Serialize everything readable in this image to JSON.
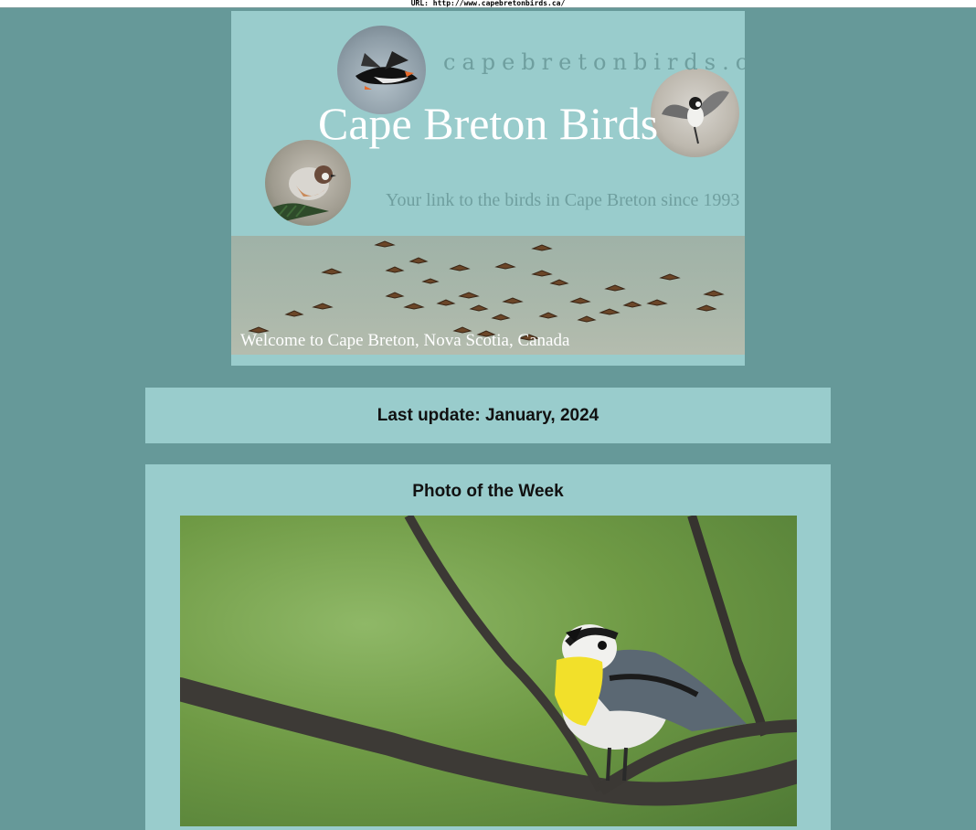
{
  "browser": {
    "url_text": "URL: http://www.capebretonbirds.ca/"
  },
  "banner": {
    "site_url": "capebretonbirds.ca",
    "title": "Cape Breton Birds",
    "tagline": "Your link to the birds in Cape Breton since 1993",
    "welcome": "Welcome to Cape Breton, Nova Scotia, Canada",
    "icons": [
      "puffin-photo",
      "chickadee-flying-photo",
      "boreal-chickadee-photo",
      "shorebird-flock-photo"
    ]
  },
  "update": {
    "text": "Last update: January, 2024"
  },
  "photo_of_week": {
    "title": "Photo of the Week",
    "image": "yellow-throated-warbler-photo"
  },
  "colors": {
    "page_bg": "#669999",
    "panel_bg": "#99cccc",
    "title_text": "#ffffff",
    "muted_text": "#6f9f9f"
  }
}
